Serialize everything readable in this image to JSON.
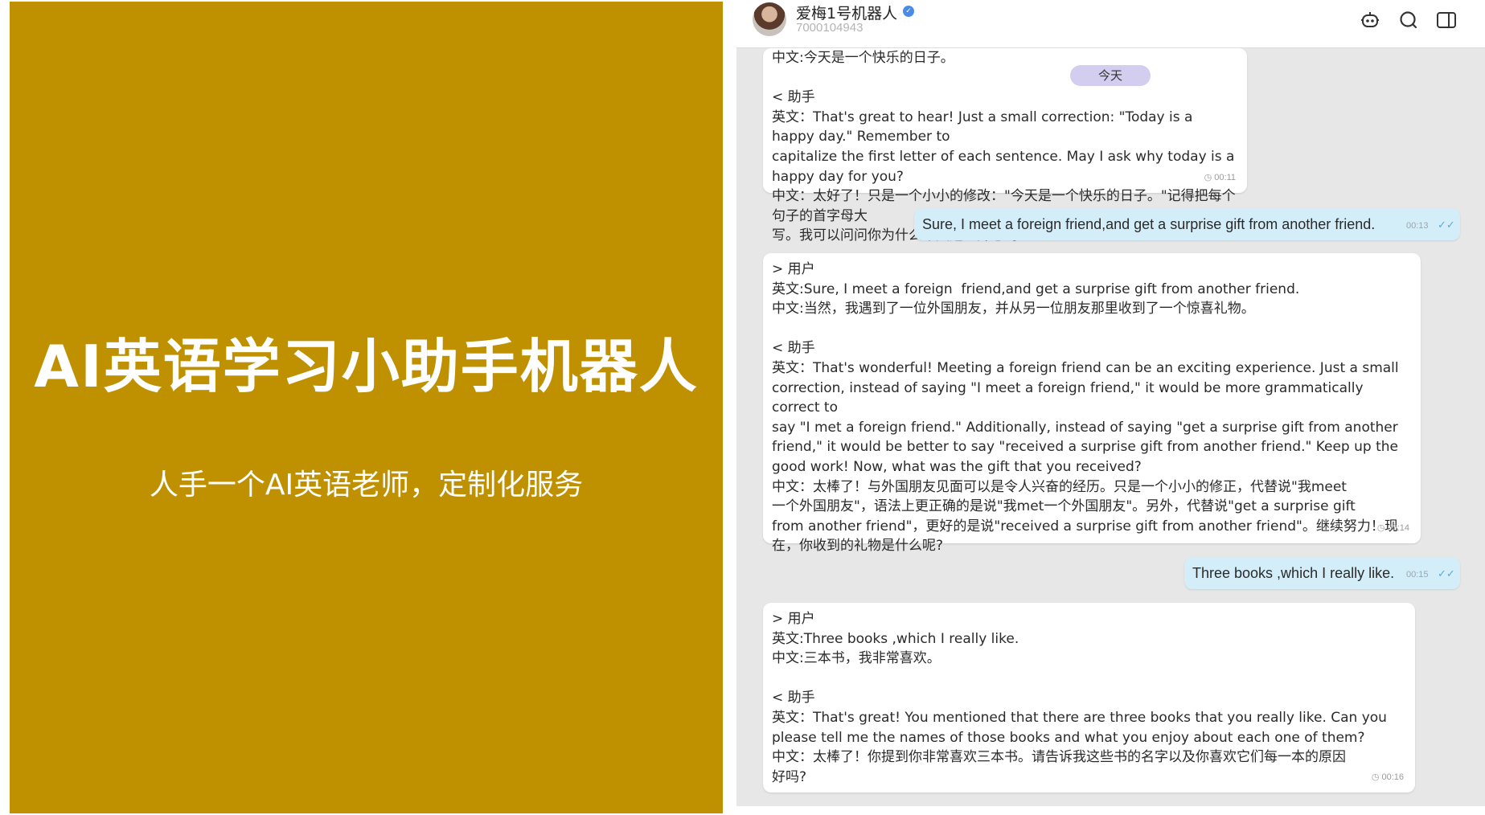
{
  "promo": {
    "title": "AI英语学习小助手机器人",
    "subtitle": "人手一个AI英语老师，定制化服务",
    "background_color": "#bf9100"
  },
  "chat": {
    "header": {
      "bot_name": "爱梅1号机器人",
      "bot_id": "7000104943",
      "icons": [
        "bot-icon",
        "search-icon",
        "sidebar-toggle-icon"
      ],
      "verified_icon": "verified-badge-icon"
    },
    "date_divider": "今天",
    "messages": [
      {
        "side": "in",
        "lines": [
          "中文:今天是一个快乐的日子。",
          "",
          "< 助手",
          "英文：That's great to hear! Just a small correction: \"Today is a happy day.\" Remember to",
          "capitalize the first letter of each sentence. May I ask why today is a happy day for you?",
          "中文：太好了！只是一个小小的修改：\"今天是一个快乐的日子。\"记得把每个句子的首字母大",
          "写。我可以问问你为什么今天这么开心吗?"
        ],
        "time": "◷ 00:11"
      },
      {
        "side": "out",
        "text": "Sure, I meet a foreign  friend,and get a surprise gift from another friend.",
        "time": "00:13",
        "status_icon": "double-check-icon"
      },
      {
        "side": "in",
        "lines": [
          "> 用户",
          "英文:Sure, I meet a foreign  friend,and get a surprise gift from another friend.",
          "中文:当然，我遇到了一位外国朋友，并从另一位朋友那里收到了一个惊喜礼物。",
          "",
          "< 助手",
          "英文：That's wonderful! Meeting a foreign friend can be an exciting experience. Just a small",
          "correction, instead of saying \"I meet a foreign friend,\" it would be more grammatically correct to",
          "say \"I met a foreign friend.\" Additionally, instead of saying \"get a surprise gift from another",
          "friend,\" it would be better to say \"received a surprise gift from another friend.\" Keep up the",
          "good work! Now, what was the gift that you received?",
          "中文：太棒了！与外国朋友见面可以是令人兴奋的经历。只是一个小小的修正，代替说\"我meet",
          "一个外国朋友\"，语法上更正确的是说\"我met一个外国朋友\"。另外，代替说\"get a surprise gift",
          "from another friend\"，更好的是说\"received a surprise gift from another friend\"。继续努力！现",
          "在，你收到的礼物是什么呢?"
        ],
        "time": "◷ 00:14"
      },
      {
        "side": "out",
        "text": "Three books ,which I really like.",
        "time": "00:15",
        "status_icon": "double-check-icon"
      },
      {
        "side": "in",
        "lines": [
          "> 用户",
          "英文:Three books ,which I really like.",
          "中文:三本书，我非常喜欢。",
          "",
          "< 助手",
          "英文：That's great! You mentioned that there are three books that you really like. Can you",
          "please tell me the names of those books and what you enjoy about each one of them?",
          "中文：太棒了！你提到你非常喜欢三本书。请告诉我这些书的名字以及你喜欢它们每一本的原因",
          "好吗?"
        ],
        "time": "◷ 00:16"
      }
    ]
  }
}
